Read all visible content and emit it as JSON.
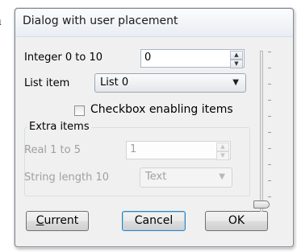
{
  "background_text": {
    "line1": "a",
    "line2": "s"
  },
  "dialog": {
    "title": "Dialog with user placement",
    "integer": {
      "label": "Integer 0 to 10",
      "value": "0"
    },
    "list": {
      "label": "List item",
      "selected": "List 0"
    },
    "checkbox": {
      "label": "Checkbox enabling items",
      "checked": false
    },
    "extra_group": {
      "title": "Extra items",
      "real": {
        "label": "Real 1 to 5",
        "value": "1"
      },
      "string": {
        "label": "String length 10",
        "value": "Text"
      }
    },
    "buttons": {
      "current_mnemonic": "C",
      "current_rest": "urrent",
      "cancel": "Cancel",
      "ok": "OK"
    },
    "slider": {
      "value_fraction": 0.0
    }
  }
}
